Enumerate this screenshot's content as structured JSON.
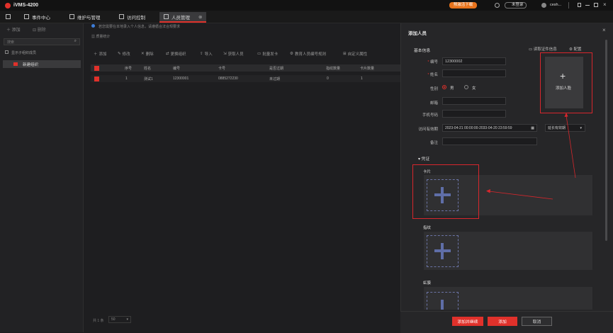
{
  "app": {
    "title": "iVMS-4200",
    "activate_label": "预激活下载",
    "user_status": "未登录",
    "user_name": "cesh..."
  },
  "tabs": [
    {
      "label": "事件中心"
    },
    {
      "label": "维护与管理"
    },
    {
      "label": "访问控制"
    },
    {
      "label": "人员管理"
    }
  ],
  "left": {
    "add_label": "添加",
    "delete_label": "删除",
    "search_placeholder": "搜索",
    "show_sub_label": "显示子组织成员",
    "org_item": "新建组织"
  },
  "main": {
    "notice": "若您需要在本地录入个人信息，请遵循合法合规要求",
    "stats_label": "质量统计",
    "toolbar": [
      "添加",
      "修改",
      "删除",
      "更换组织",
      "导入",
      "获取人员",
      "批量发卡",
      "教育人员编号规则",
      "自定义属性"
    ],
    "columns": [
      "序号",
      "姓名",
      "编号",
      "卡号",
      "是否过期",
      "指纹数量",
      "卡片数量"
    ],
    "rows": [
      [
        "1",
        "测试1",
        "12300001",
        "0885272230",
        "未过期",
        "0",
        "1"
      ]
    ],
    "footer_total": "共 1 条",
    "footer_page_size": "50"
  },
  "dialog": {
    "title": "添加人员",
    "basic_info": "基本信息",
    "read_id_label": "读取证件信息",
    "config_label": "配置",
    "fields": {
      "id_label": "编号",
      "id_value": "12300002",
      "name_label": "姓名",
      "name_value": "",
      "gender_label": "性别",
      "male": "男",
      "female": "女",
      "email_label": "邮箱",
      "phone_label": "手机号码",
      "validity_label": "访问有效期",
      "validity_value": "2023-04-21 00:00:00-2033-04-20 23:59:59",
      "extend_label": "延长有效期",
      "remark_label": "备注"
    },
    "add_face_label": "添加人脸",
    "credential_label": "凭证",
    "card_label": "卡片",
    "fingerprint_label": "指纹",
    "iris_label": "虹膜",
    "buttons": {
      "add_continue": "添加并继续",
      "add": "添加",
      "cancel": "取消"
    }
  },
  "colors": {
    "accent": "#e0312b",
    "dialog_bg": "#262628",
    "add_icon": "#5f6ea8"
  }
}
